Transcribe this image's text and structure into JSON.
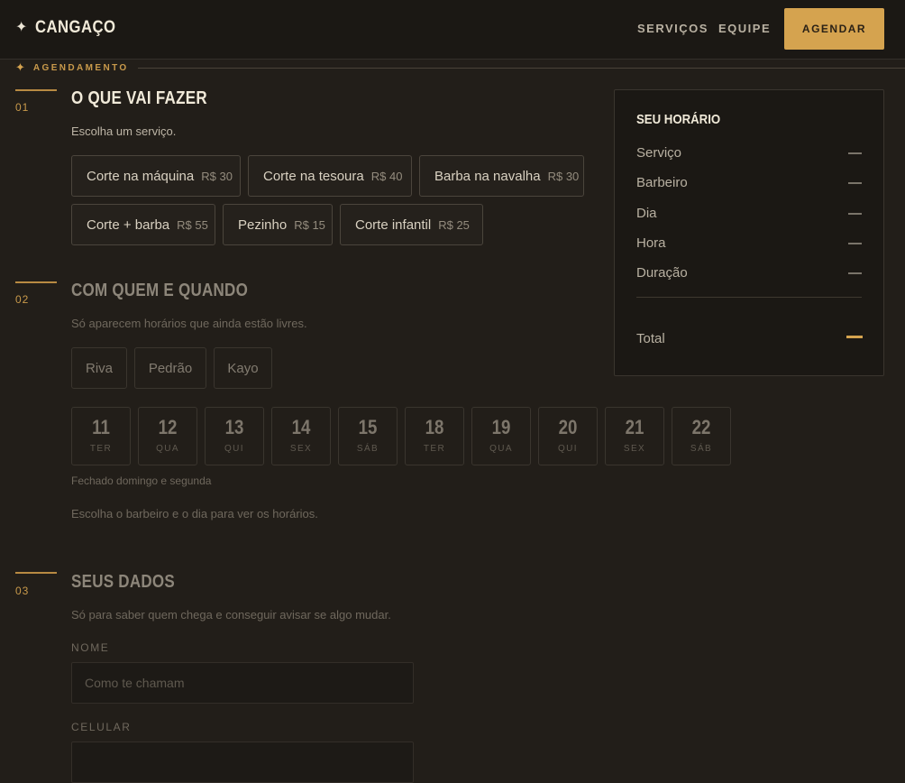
{
  "header": {
    "brand": "CANGAÇO",
    "nav": [
      "SERVIÇOS",
      "EQUIPE"
    ],
    "cta": "AGENDAR"
  },
  "section_label": "AGENDAMENTO",
  "steps": [
    {
      "num": "01",
      "title": "O QUE VAI FAZER",
      "subtitle": "Escolha um serviço."
    },
    {
      "num": "02",
      "title": "COM QUEM E QUANDO",
      "subtitle": "Só aparecem horários que ainda estão livres."
    },
    {
      "num": "03",
      "title": "SEUS DADOS",
      "subtitle": "Só para saber quem chega e conseguir avisar se algo mudar."
    }
  ],
  "services": [
    {
      "name": "Corte na máquina",
      "price": "R$ 30"
    },
    {
      "name": "Corte na tesoura",
      "price": "R$ 40"
    },
    {
      "name": "Barba na navalha",
      "price": "R$ 30"
    },
    {
      "name": "Corte + barba",
      "price": "R$ 55"
    },
    {
      "name": "Pezinho",
      "price": "R$ 15"
    },
    {
      "name": "Corte infantil",
      "price": "R$ 25"
    }
  ],
  "barbers": [
    "Riva",
    "Pedrão",
    "Kayo"
  ],
  "days": [
    {
      "day": "11",
      "weekday": "TER"
    },
    {
      "day": "12",
      "weekday": "QUA"
    },
    {
      "day": "13",
      "weekday": "QUI"
    },
    {
      "day": "14",
      "weekday": "SEX"
    },
    {
      "day": "15",
      "weekday": "SÁB"
    },
    {
      "day": "18",
      "weekday": "TER"
    },
    {
      "day": "19",
      "weekday": "QUA"
    },
    {
      "day": "20",
      "weekday": "QUI"
    },
    {
      "day": "21",
      "weekday": "SEX"
    },
    {
      "day": "22",
      "weekday": "SÁB"
    }
  ],
  "closed_note": "Fechado domingo e segunda",
  "hint": "Escolha o barbeiro e o dia para ver os horários.",
  "form": {
    "name_label": "NOME",
    "name_placeholder": "Como te chamam",
    "phone_label": "CELULAR"
  },
  "summary": {
    "title": "SEU HORÁRIO",
    "rows": [
      {
        "label": "Serviço",
        "value": "—"
      },
      {
        "label": "Barbeiro",
        "value": "—"
      },
      {
        "label": "Dia",
        "value": "—"
      },
      {
        "label": "Hora",
        "value": "—"
      },
      {
        "label": "Duração",
        "value": "—"
      }
    ],
    "total_label": "Total"
  },
  "colors": {
    "accent": "#d5a34f",
    "background": "#221e19"
  }
}
